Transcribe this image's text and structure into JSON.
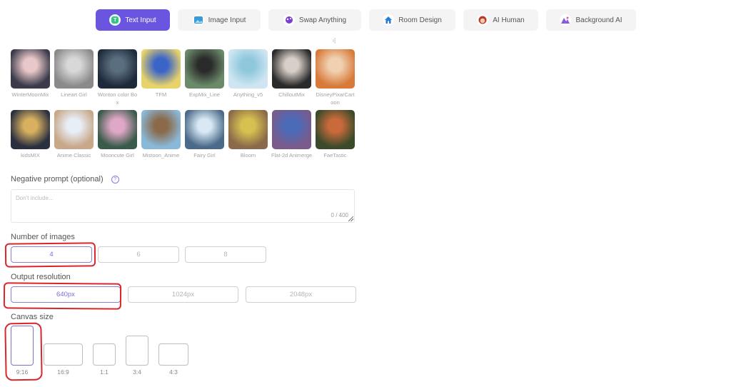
{
  "tabs": [
    {
      "label": "Text Input",
      "icon": "text-icon",
      "active": true
    },
    {
      "label": "Image Input",
      "icon": "image-icon",
      "active": false
    },
    {
      "label": "Swap Anything",
      "icon": "swap-icon",
      "active": false
    },
    {
      "label": "Room Design",
      "icon": "house-icon",
      "active": false
    },
    {
      "label": "AI Human",
      "icon": "human-face-icon",
      "active": false
    },
    {
      "label": "Background AI",
      "icon": "background-icon",
      "active": false
    }
  ],
  "stray_mark": "ı]",
  "models": [
    {
      "name": "WinterMoonMix",
      "colors": [
        "#3a3a4a",
        "#e8c8c8"
      ]
    },
    {
      "name": "Lineart Girl",
      "colors": [
        "#8a8a8a",
        "#d8d8d8"
      ]
    },
    {
      "name": "Wonton color Box",
      "colors": [
        "#1e2a3a",
        "#5a6e80"
      ]
    },
    {
      "name": "TFM",
      "colors": [
        "#e8d36a",
        "#3a64c8"
      ]
    },
    {
      "name": "ExpMix_Line",
      "colors": [
        "#6a8a6a",
        "#2a2a2a"
      ]
    },
    {
      "name": "Anything_v5",
      "colors": [
        "#cfe6f2",
        "#8fc8dc"
      ]
    },
    {
      "name": "ChilloutMix",
      "colors": [
        "#2a2a2a",
        "#d8cfc8"
      ]
    },
    {
      "name": "DisneyPixarCartoon",
      "colors": [
        "#d87a3a",
        "#f0d0b0"
      ]
    },
    {
      "name": "kidsMIX",
      "colors": [
        "#2a3040",
        "#d8b060"
      ]
    },
    {
      "name": "Anime Classic",
      "colors": [
        "#c8a888",
        "#e8eef8"
      ]
    },
    {
      "name": "Mooncute Girl",
      "colors": [
        "#3a5a4a",
        "#e0a8c8"
      ]
    },
    {
      "name": "Mistoon_Anime",
      "colors": [
        "#8ab8d8",
        "#8a6a4a"
      ]
    },
    {
      "name": "Fairy Girl",
      "colors": [
        "#4a6a8a",
        "#d8e8f4"
      ]
    },
    {
      "name": "Bloom",
      "colors": [
        "#8a6a4a",
        "#d8c050"
      ]
    },
    {
      "name": "Flat-2d Animerge",
      "colors": [
        "#7a5a8a",
        "#4a6ab8"
      ]
    },
    {
      "name": "FaeTastic",
      "colors": [
        "#3a4a2a",
        "#c86a3a"
      ]
    }
  ],
  "negative_prompt": {
    "label": "Negative prompt (optional)",
    "help_icon": "?",
    "placeholder": "Don't include...",
    "counter": "0 / 400"
  },
  "number_of_images": {
    "label": "Number of images",
    "options": [
      "4",
      "6",
      "8"
    ],
    "selected": "4"
  },
  "output_resolution": {
    "label": "Output resolution",
    "options": [
      "640px",
      "1024px",
      "2048px"
    ],
    "selected": "640px"
  },
  "canvas_size": {
    "label": "Canvas size",
    "options": [
      "9:16",
      "16:9",
      "1:1",
      "3:4",
      "4:3"
    ],
    "selected": "9:16"
  },
  "annotation_color": "#d9262b"
}
